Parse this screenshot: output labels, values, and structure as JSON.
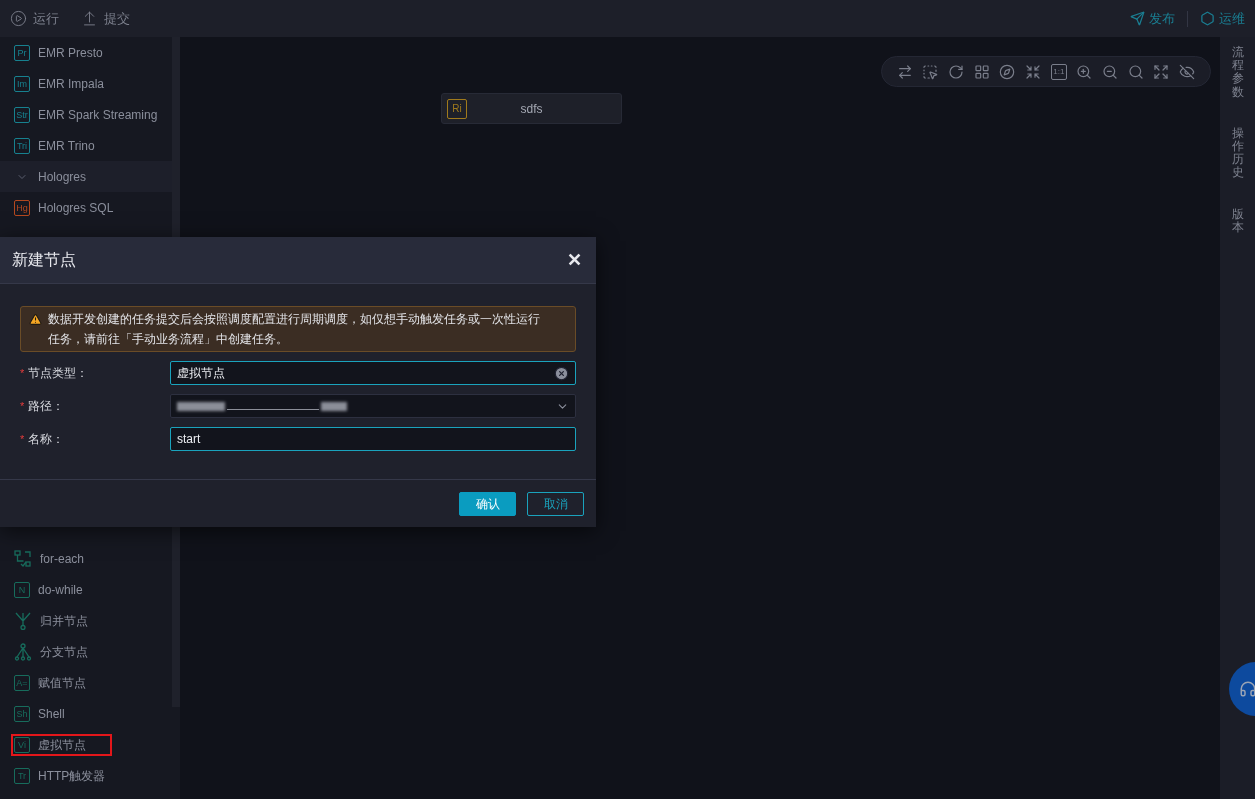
{
  "top_bar": {
    "left_actions": [
      {
        "kind": "run",
        "label": "运行"
      },
      {
        "kind": "submit",
        "label": "提交"
      }
    ],
    "right_actions": [
      {
        "kind": "publish",
        "label": "发布"
      },
      {
        "kind": "ops",
        "label": "运维"
      }
    ]
  },
  "sidebar": {
    "top_items": [
      {
        "kind": "badge",
        "badge": "Pr",
        "label": "EMR Presto",
        "color": "#17818f"
      },
      {
        "kind": "badge",
        "badge": "Im",
        "label": "EMR Impala",
        "color": "#17818f"
      },
      {
        "kind": "badge",
        "badge": "Str",
        "label": "EMR Spark Streaming",
        "color": "#17818f"
      },
      {
        "kind": "badge",
        "badge": "Tri",
        "label": "EMR Trino",
        "color": "#17818f"
      },
      {
        "kind": "group",
        "label": "Hologres",
        "expanded": true
      },
      {
        "kind": "badge",
        "badge": "Hg",
        "label": "Hologres SQL",
        "color": "#b4481f"
      }
    ],
    "bottom_items": [
      {
        "kind": "loop",
        "label": "for-each",
        "highlighted": false
      },
      {
        "kind": "badge",
        "badge": "N",
        "label": "do-while",
        "color": "#176c5c",
        "highlighted": false
      },
      {
        "kind": "merge",
        "label": "归并节点",
        "highlighted": false
      },
      {
        "kind": "branch",
        "label": "分支节点",
        "highlighted": false
      },
      {
        "kind": "badge",
        "badge": "A=",
        "label": "赋值节点",
        "color": "#176c5c",
        "highlighted": false
      },
      {
        "kind": "badge",
        "badge": "Sh",
        "label": "Shell",
        "color": "#176c5c",
        "highlighted": false
      },
      {
        "kind": "badge",
        "badge": "Vi",
        "label": "虚拟节点",
        "color": "#176c5c",
        "highlighted": true
      },
      {
        "kind": "badge",
        "badge": "Tr",
        "label": "HTTP触发器",
        "color": "#176c5c",
        "highlighted": false
      }
    ]
  },
  "canvas": {
    "toolbar": {
      "ratio_label": "1:1"
    },
    "nodes": [
      {
        "badge": "Ri",
        "label": "sdfs"
      }
    ]
  },
  "right_panel": {
    "tabs": [
      "流程参数",
      "操作历史",
      "版本"
    ]
  },
  "dialog": {
    "title": "新建节点",
    "close": "✕",
    "warning": "数据开发创建的任务提交后会按照调度配置进行周期调度，如仅想手动触发任务或一次性运行任务，请前往「手动业务流程」中创建任务。",
    "fields": [
      {
        "kind": "select",
        "label": "节点类型：",
        "required_mark": "*",
        "value": "虚拟节点",
        "focused": true,
        "clearable": true
      },
      {
        "kind": "path",
        "label": "路径：",
        "required_mark": "*",
        "redacted": true,
        "focused": false
      },
      {
        "kind": "text",
        "label": "名称：",
        "required_mark": "*",
        "value": "start",
        "focused": true
      }
    ],
    "buttons": [
      {
        "label": "确认",
        "primary": true
      },
      {
        "label": "取消",
        "primary": false
      }
    ]
  }
}
